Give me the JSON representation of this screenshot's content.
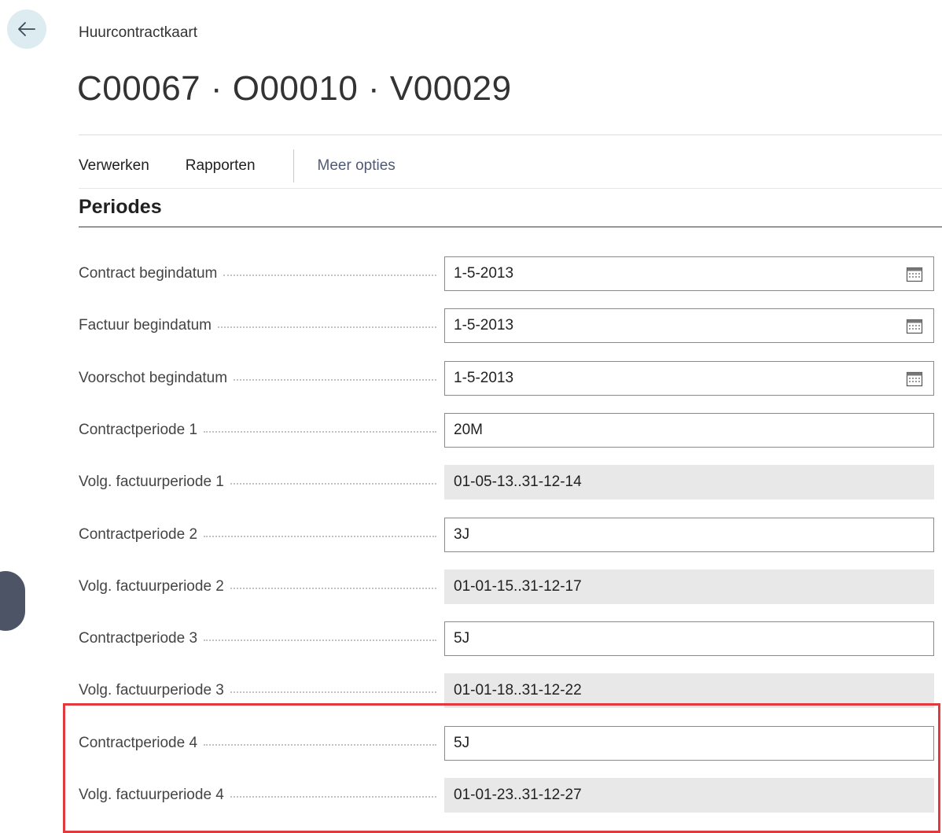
{
  "header": {
    "breadcrumb": "Huurcontractkaart",
    "title": "C00067 · O00010 · V00029"
  },
  "actions": {
    "process": "Verwerken",
    "reports": "Rapporten",
    "more": "Meer opties"
  },
  "section": {
    "title": "Periodes"
  },
  "fields": [
    {
      "label": "Contract begindatum",
      "value": "1-5-2013",
      "editable": true,
      "icon": "calendar-icon"
    },
    {
      "label": "Factuur begindatum",
      "value": "1-5-2013",
      "editable": true,
      "icon": "calendar-icon"
    },
    {
      "label": "Voorschot begindatum",
      "value": "1-5-2013",
      "editable": true,
      "icon": "calendar-icon"
    },
    {
      "label": "Contractperiode 1",
      "value": "20M",
      "editable": true
    },
    {
      "label": "Volg. factuurperiode 1",
      "value": "01-05-13..31-12-14",
      "editable": false
    },
    {
      "label": "Contractperiode 2",
      "value": "3J",
      "editable": true
    },
    {
      "label": "Volg. factuurperiode 2",
      "value": "01-01-15..31-12-17",
      "editable": false
    },
    {
      "label": "Contractperiode 3",
      "value": "5J",
      "editable": true
    },
    {
      "label": "Volg. factuurperiode 3",
      "value": "01-01-18..31-12-22",
      "editable": false
    },
    {
      "label": "Contractperiode 4",
      "value": "5J",
      "editable": true
    },
    {
      "label": "Volg. factuurperiode 4",
      "value": "01-01-23..31-12-27",
      "editable": false
    }
  ],
  "colors": {
    "highlight": "#e0393e",
    "back_button_bg": "#dcecf0",
    "readonly_bg": "#e8e8e8"
  }
}
